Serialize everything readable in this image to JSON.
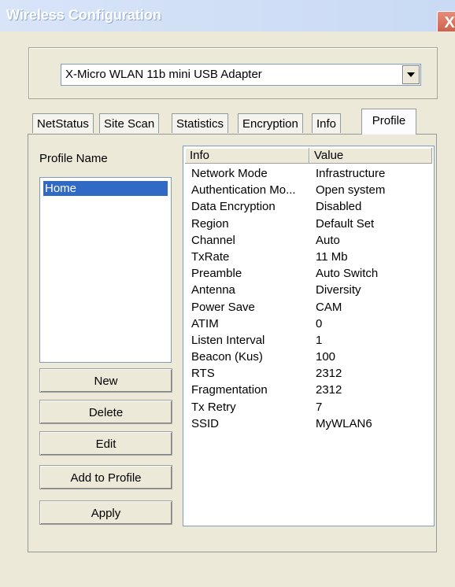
{
  "window": {
    "title": "Wireless Configuration",
    "close_label": "X"
  },
  "adapter": {
    "selected": "X-Micro WLAN 11b mini USB Adapter"
  },
  "tabs": [
    {
      "label": "NetStatus"
    },
    {
      "label": "Site Scan"
    },
    {
      "label": "Statistics"
    },
    {
      "label": "Encryption"
    },
    {
      "label": "Info"
    },
    {
      "label": "Profile",
      "active": true
    }
  ],
  "profile": {
    "name_label": "Profile Name",
    "profiles": [
      "Home"
    ],
    "buttons": {
      "new": "New",
      "delete": "Delete",
      "edit": "Edit",
      "add_to_profile": "Add to Profile",
      "apply": "Apply"
    }
  },
  "info_table": {
    "headers": {
      "info": "Info",
      "value": "Value"
    },
    "rows": [
      {
        "info": "Network Mode",
        "value": "Infrastructure"
      },
      {
        "info": "Authentication Mo...",
        "value": "Open system"
      },
      {
        "info": "Data Encryption",
        "value": "Disabled"
      },
      {
        "info": "Region",
        "value": "Default Set"
      },
      {
        "info": "Channel",
        "value": "Auto"
      },
      {
        "info": "TxRate",
        "value": "11 Mb"
      },
      {
        "info": "Preamble",
        "value": "Auto Switch"
      },
      {
        "info": "Antenna",
        "value": "Diversity"
      },
      {
        "info": "Power Save",
        "value": "CAM"
      },
      {
        "info": "ATIM",
        "value": "0"
      },
      {
        "info": "Listen Interval",
        "value": "1"
      },
      {
        "info": "Beacon (Kus)",
        "value": "100"
      },
      {
        "info": "RTS",
        "value": "2312"
      },
      {
        "info": "Fragmentation",
        "value": "2312"
      },
      {
        "info": "Tx Retry",
        "value": "7"
      },
      {
        "info": "SSID",
        "value": "MyWLAN6"
      }
    ]
  }
}
